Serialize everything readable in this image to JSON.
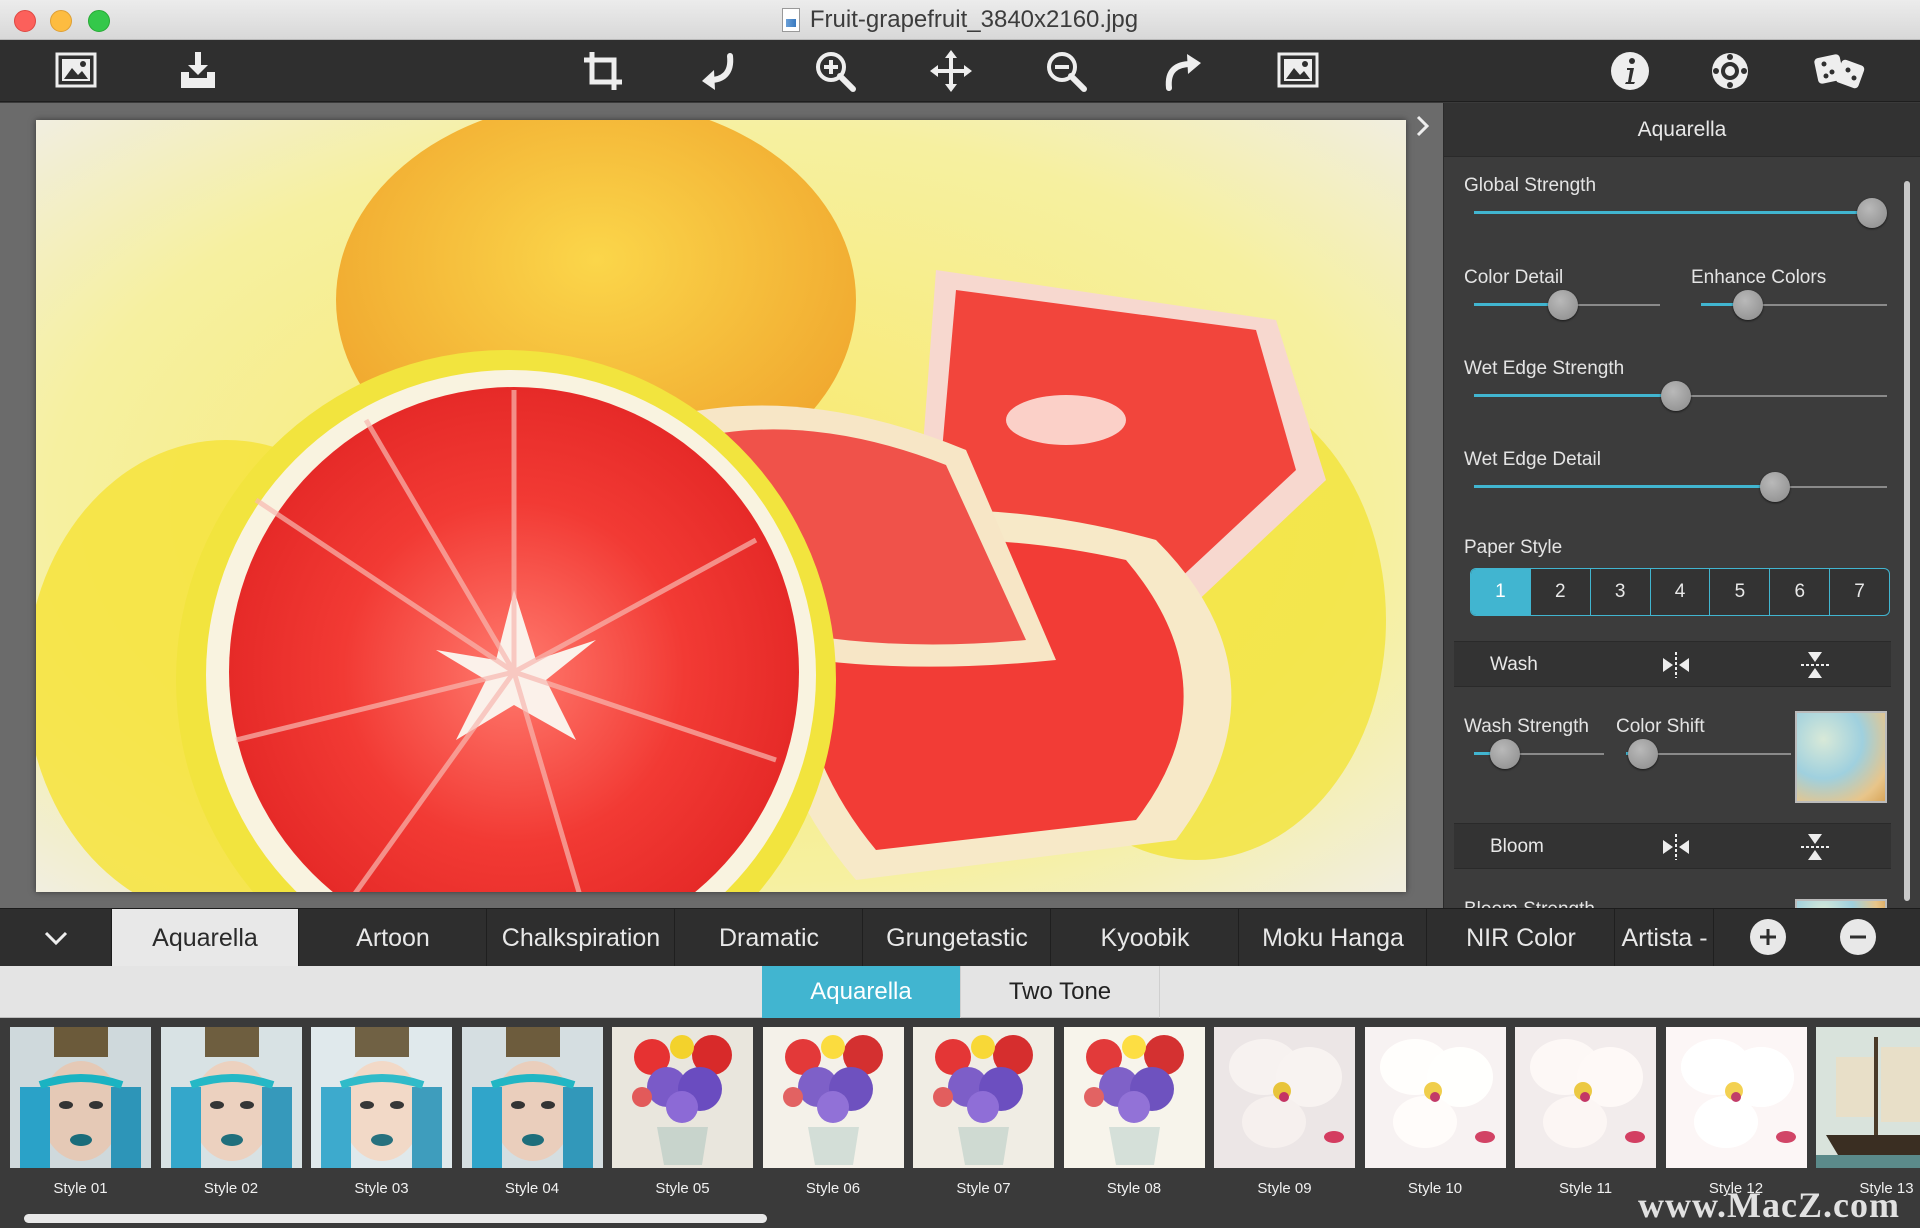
{
  "window": {
    "title": "Fruit-grapefruit_3840x2160.jpg"
  },
  "toolbar": {
    "left": [
      {
        "icon": "open-image-icon",
        "label": "Open image"
      },
      {
        "icon": "save-download-icon",
        "label": "Save"
      }
    ],
    "center": [
      {
        "icon": "crop-icon"
      },
      {
        "icon": "undo-icon"
      },
      {
        "icon": "zoom-in-icon"
      },
      {
        "icon": "pan-move-icon"
      },
      {
        "icon": "zoom-out-icon"
      },
      {
        "icon": "redo-icon"
      },
      {
        "icon": "fit-image-icon"
      }
    ],
    "right": [
      {
        "icon": "info-icon"
      },
      {
        "icon": "settings-icon"
      },
      {
        "icon": "random-dice-icon"
      }
    ]
  },
  "panel": {
    "title": "Aquarella",
    "sliders": {
      "global_strength": {
        "label": "Global Strength",
        "value": 1.0
      },
      "color_detail": {
        "label": "Color Detail",
        "value": 0.48
      },
      "enhance_colors": {
        "label": "Enhance Colors",
        "value": 0.25
      },
      "wet_edge_strength": {
        "label": "Wet Edge Strength",
        "value": 0.49
      },
      "wet_edge_detail": {
        "label": "Wet Edge Detail",
        "value": 0.73
      },
      "wash_strength": {
        "label": "Wash Strength",
        "value": 0.24
      },
      "color_shift": {
        "label": "Color Shift",
        "value": 0.1
      }
    },
    "paper_style": {
      "label": "Paper Style",
      "options": [
        "1",
        "2",
        "3",
        "4",
        "5",
        "6",
        "7"
      ],
      "selected": "1"
    },
    "sections": {
      "wash": "Wash",
      "bloom": "Bloom",
      "bloom_strength_partial": "Bloom Strength"
    }
  },
  "categories": {
    "tabs": [
      "Aquarella",
      "Artoon",
      "Chalkspiration",
      "Dramatic",
      "Grungetastic",
      "Kyoobik",
      "Moku Hanga",
      "NIR Color",
      "Artista -"
    ],
    "active": "Aquarella"
  },
  "subtabs": {
    "items": [
      "Aquarella",
      "Two Tone"
    ],
    "active": "Aquarella"
  },
  "styles": {
    "items": [
      "Style 01",
      "Style 02",
      "Style 03",
      "Style 04",
      "Style 05",
      "Style 06",
      "Style 07",
      "Style 08",
      "Style 09",
      "Style 10",
      "Style 11",
      "Style 12",
      "Style 13"
    ]
  },
  "watermark": "www.MacZ.com",
  "colors": {
    "accent": "#41b5d0",
    "toolbar": "#2f2f2f",
    "panel": "#3c3c3c"
  }
}
